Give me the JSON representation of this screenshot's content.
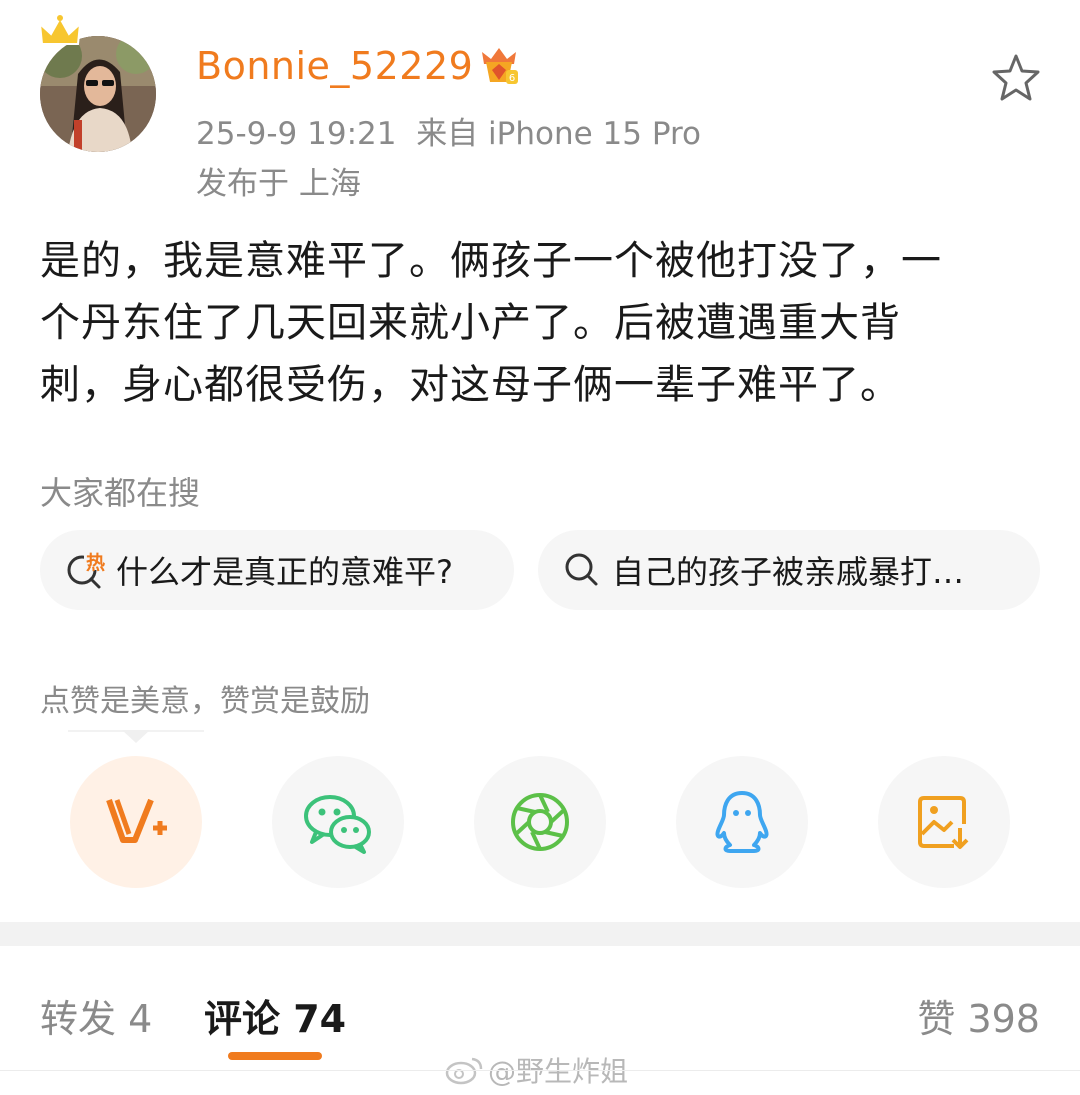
{
  "post": {
    "username": "Bonnie_52229",
    "timestamp": "25-9-9 19:21",
    "source": "来自 iPhone 15 Pro",
    "location": "发布于 上海",
    "lines": [
      "是的，我是意难平了。俩孩子一个被他打没了，一",
      "个丹东住了几天回来就小产了。后被遭遇重大背",
      "刺，身心都很受伤，对这母子俩一辈子难平了。"
    ]
  },
  "search": {
    "title": "大家都在搜",
    "chips": [
      {
        "label": "什么才是真正的意难平?",
        "badge": "热",
        "icon": "hot-search-icon"
      },
      {
        "label": "自己的孩子被亲戚暴打…",
        "icon": "search-icon"
      }
    ]
  },
  "reward": {
    "tip": "点赞是美意，赞赏是鼓励"
  },
  "share": {
    "buttons": [
      {
        "icon": "weibo-reward-v-plus-icon",
        "color": "#f07b1e"
      },
      {
        "icon": "wechat-icon",
        "color": "#3cc27a"
      },
      {
        "icon": "wechat-moments-icon",
        "color": "#5cc048"
      },
      {
        "icon": "qq-icon",
        "color": "#3ea6f0"
      },
      {
        "icon": "save-image-icon",
        "color": "#f0a020"
      }
    ]
  },
  "tabs": {
    "repost": "转发 4",
    "comment": "评论 74",
    "like": "赞 398"
  },
  "watermark": "@野生炸姐",
  "colors": {
    "accent": "#f07b1e",
    "muted": "#8a8a8a",
    "chip_bg": "#f6f6f6"
  }
}
